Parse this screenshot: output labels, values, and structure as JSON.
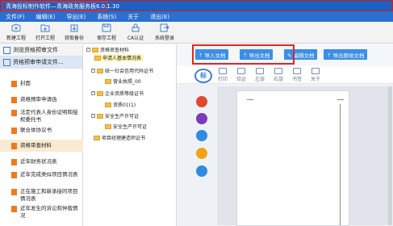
{
  "app": {
    "title": "青海投标制作软件—青海政务服务板6.0.1.30"
  },
  "menu": {
    "items": [
      "文件(F)",
      "编辑(E)",
      "导出(E)",
      "系统(S)",
      "关于",
      "退出(E)"
    ]
  },
  "toolbar": {
    "buttons": [
      {
        "label": "新建工程",
        "icon": "new-project-icon",
        "color": "#3c7fd3"
      },
      {
        "label": "打开工程",
        "icon": "open-project-icon",
        "color": "#3c7fd3"
      },
      {
        "label": "获取备份",
        "icon": "backup-icon",
        "color": "#3c7fd3"
      },
      {
        "label": "保存工程",
        "icon": "save-icon",
        "color": "#3c7fd3"
      },
      {
        "label": "CA认证",
        "icon": "ca-cert-icon",
        "color": "#3c7fd3"
      },
      {
        "label": "系统登录",
        "icon": "login-icon",
        "color": "#3c7fd3"
      }
    ]
  },
  "sidebar": {
    "sections": [
      "浏览资格预审文件",
      "资格预审申请文件..."
    ],
    "items": [
      "封面",
      "资格预审申请函",
      "法定代表人身份证明和授权委托书",
      "联合体协议书",
      "资格审查材料",
      "近年财务状况表",
      "近年完成类似项目情况表",
      "正在施工和新承接的项目情况表",
      "近年发生的诉讼和仲裁情况"
    ]
  },
  "tree": {
    "nodes": [
      "资格审查材料",
      "申请人基本情况表",
      "统一社会信用代码证书",
      "营业执照_00",
      "企业资质等级证书",
      "资质01(1)",
      "安全生产许可证",
      "安全生产许可证",
      "项目经理建造师证书"
    ]
  },
  "viewer": {
    "buttons": [
      "导入文档",
      "导出文档",
      "编辑文档",
      "导出原始文档"
    ],
    "reader_tools": [
      "打印",
      "验证",
      "左旋",
      "右旋",
      "书签",
      "关于"
    ],
    "logo_text": "标",
    "side_icon_colors": [
      "#e2472f",
      "#7d3bb8",
      "#2f8be0",
      "#f2a21a",
      "#2f8be0"
    ],
    "accent": "#3c8ee6",
    "highlight": "#e0281f"
  }
}
